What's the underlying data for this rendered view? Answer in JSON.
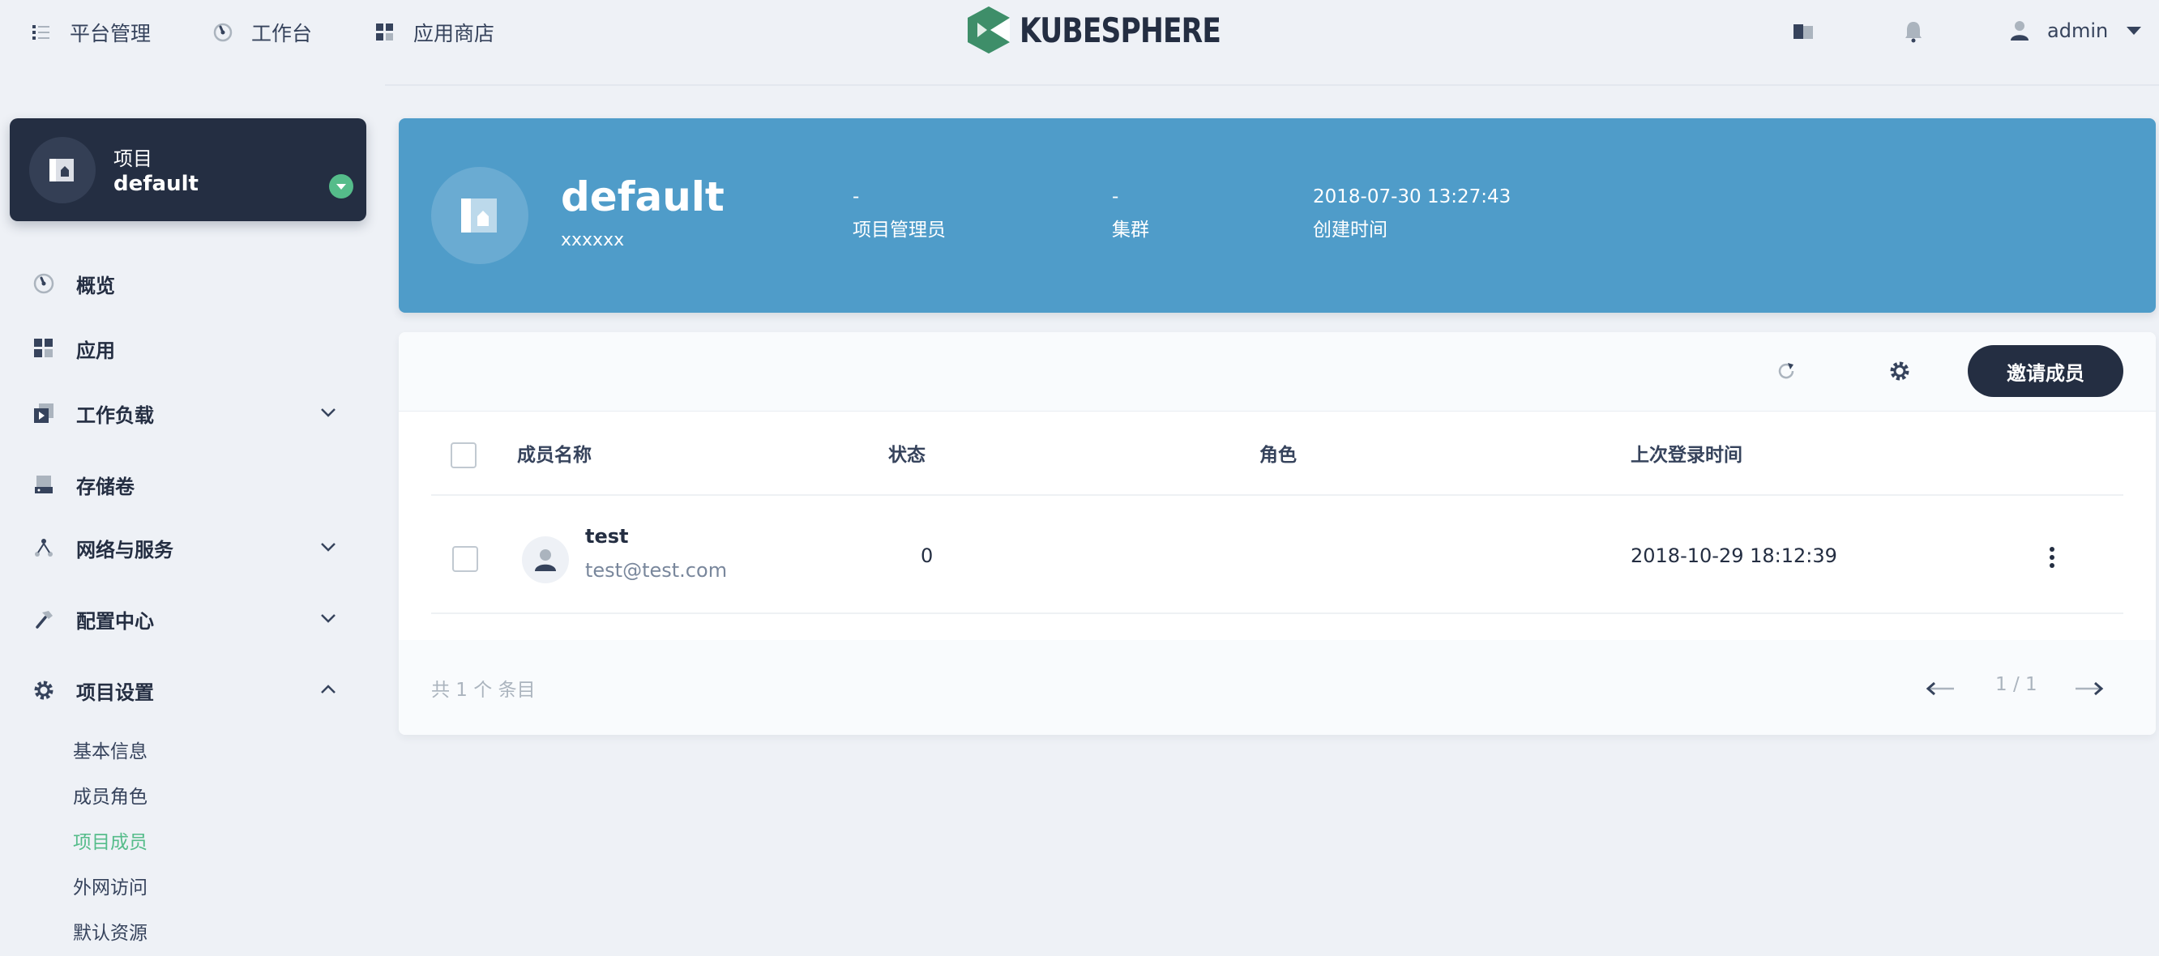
{
  "topnav": {
    "items": [
      {
        "label": "平台管理",
        "icon": "list-icon"
      },
      {
        "label": "工作台",
        "icon": "dashboard-icon"
      },
      {
        "label": "应用商店",
        "icon": "appstore-icon"
      }
    ],
    "logo_text": "KUBESPHERE",
    "user": {
      "name": "admin"
    }
  },
  "sidebar": {
    "project": {
      "label": "项目",
      "name": "default"
    },
    "items": [
      {
        "label": "概览",
        "icon": "overview-icon"
      },
      {
        "label": "应用",
        "icon": "app-icon"
      },
      {
        "label": "工作负载",
        "icon": "workload-icon"
      },
      {
        "label": "存储卷",
        "icon": "storage-icon"
      },
      {
        "label": "网络与服务",
        "icon": "network-icon"
      },
      {
        "label": "配置中心",
        "icon": "hammer-icon"
      },
      {
        "label": "项目设置",
        "icon": "gear-icon"
      }
    ],
    "subitems": [
      "基本信息",
      "成员角色",
      "项目成员",
      "外网访问",
      "默认资源"
    ],
    "active_subitem": "项目成员"
  },
  "banner": {
    "title": "default",
    "description": "xxxxxx",
    "stats": [
      {
        "value": "-",
        "label": "项目管理员"
      },
      {
        "value": "-",
        "label": "集群"
      },
      {
        "value": "2018-07-30 13:27:43",
        "label": "创建时间"
      }
    ]
  },
  "toolbar": {
    "invite_label": "邀请成员"
  },
  "table": {
    "columns": [
      "成员名称",
      "状态",
      "角色",
      "上次登录时间"
    ],
    "rows": [
      {
        "name": "test",
        "email": "test@test.com",
        "status": "0",
        "role": "",
        "last_login": "2018-10-29 18:12:39"
      }
    ]
  },
  "pagination": {
    "total": "共 1 个 条目",
    "page": "1 / 1"
  },
  "colors": {
    "primary": "#242e42",
    "accent": "#55bc8a",
    "banner": "#4f9cc9",
    "background": "#eef1f6"
  }
}
